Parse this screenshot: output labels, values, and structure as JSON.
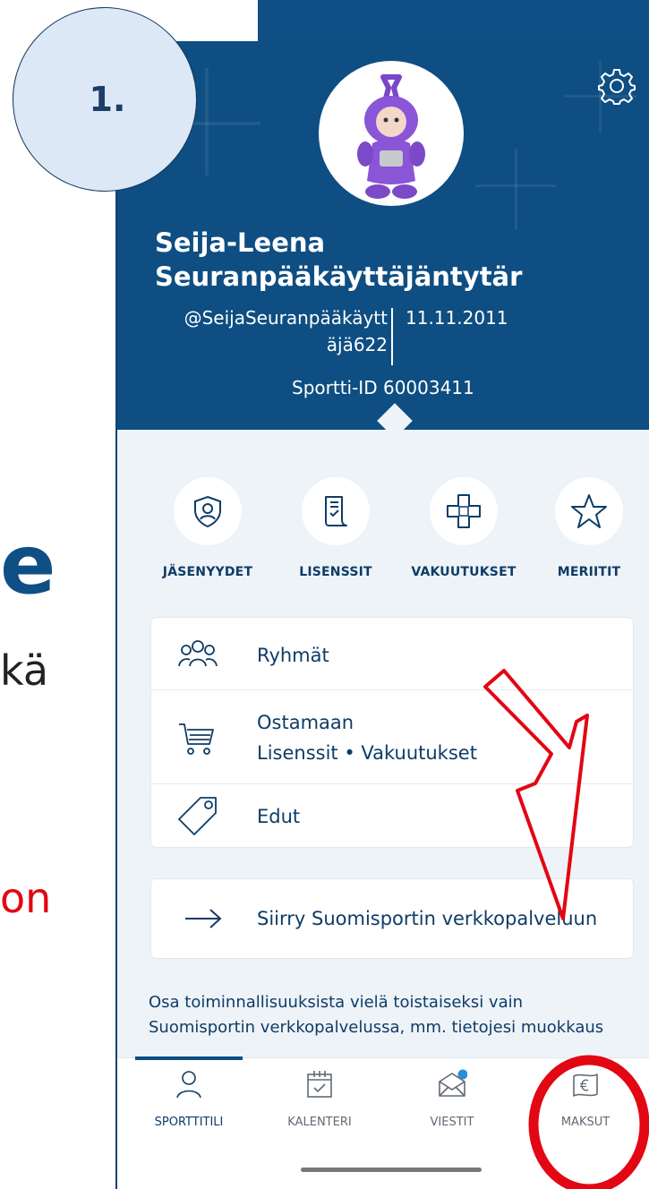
{
  "step": {
    "label": "1."
  },
  "background": {
    "fragment_e": "e",
    "fragment_ka": "kä",
    "fragment_on": "on"
  },
  "profile": {
    "name_line1": "Seija-Leena",
    "name_line2": "Seuranpääkäyttäjäntytär",
    "username_line1": "@SeijaSeuranpääkäytt",
    "username_line2": "äjä622",
    "birthdate": "11.11.2011",
    "sportti_id": "Sportti-ID 60003411"
  },
  "quick_actions": [
    {
      "label": "JÄSENYYDET",
      "icon": "shield-user-icon"
    },
    {
      "label": "LISENSSIT",
      "icon": "license-document-icon"
    },
    {
      "label": "VAKUUTUKSET",
      "icon": "bandage-cross-icon"
    },
    {
      "label": "MERIITIT",
      "icon": "star-icon"
    }
  ],
  "menu": {
    "groups": {
      "label": "Ryhmät",
      "icon": "users-group-icon"
    },
    "buy": {
      "label": "Ostamaan",
      "sublabel": "Lisenssit • Vakuutukset",
      "icon": "shopping-cart-icon"
    },
    "benefits": {
      "label": "Edut",
      "icon": "price-tag-icon"
    }
  },
  "web_service": {
    "label": "Siirry Suomisportin verkkopalveluun",
    "icon": "arrow-right-icon"
  },
  "info": {
    "line1": "Osa toiminnallisuuksista vielä toistaiseksi vain",
    "line2": "Suomisportin verkkopalvelussa, mm. tietojesi muokkaus"
  },
  "nav": [
    {
      "label": "SPORTTITILI",
      "icon": "person-icon",
      "active": true
    },
    {
      "label": "KALENTERI",
      "icon": "calendar-icon",
      "active": false
    },
    {
      "label": "VIESTIT",
      "icon": "envelope-icon",
      "active": false,
      "badge": true
    },
    {
      "label": "MAKSUT",
      "icon": "euro-banknote-icon",
      "active": false
    }
  ],
  "colors": {
    "header": "#0e4e82",
    "primary_text": "#0e3c66",
    "annotation_red": "#e30613",
    "badge": "#2a8fd8"
  }
}
